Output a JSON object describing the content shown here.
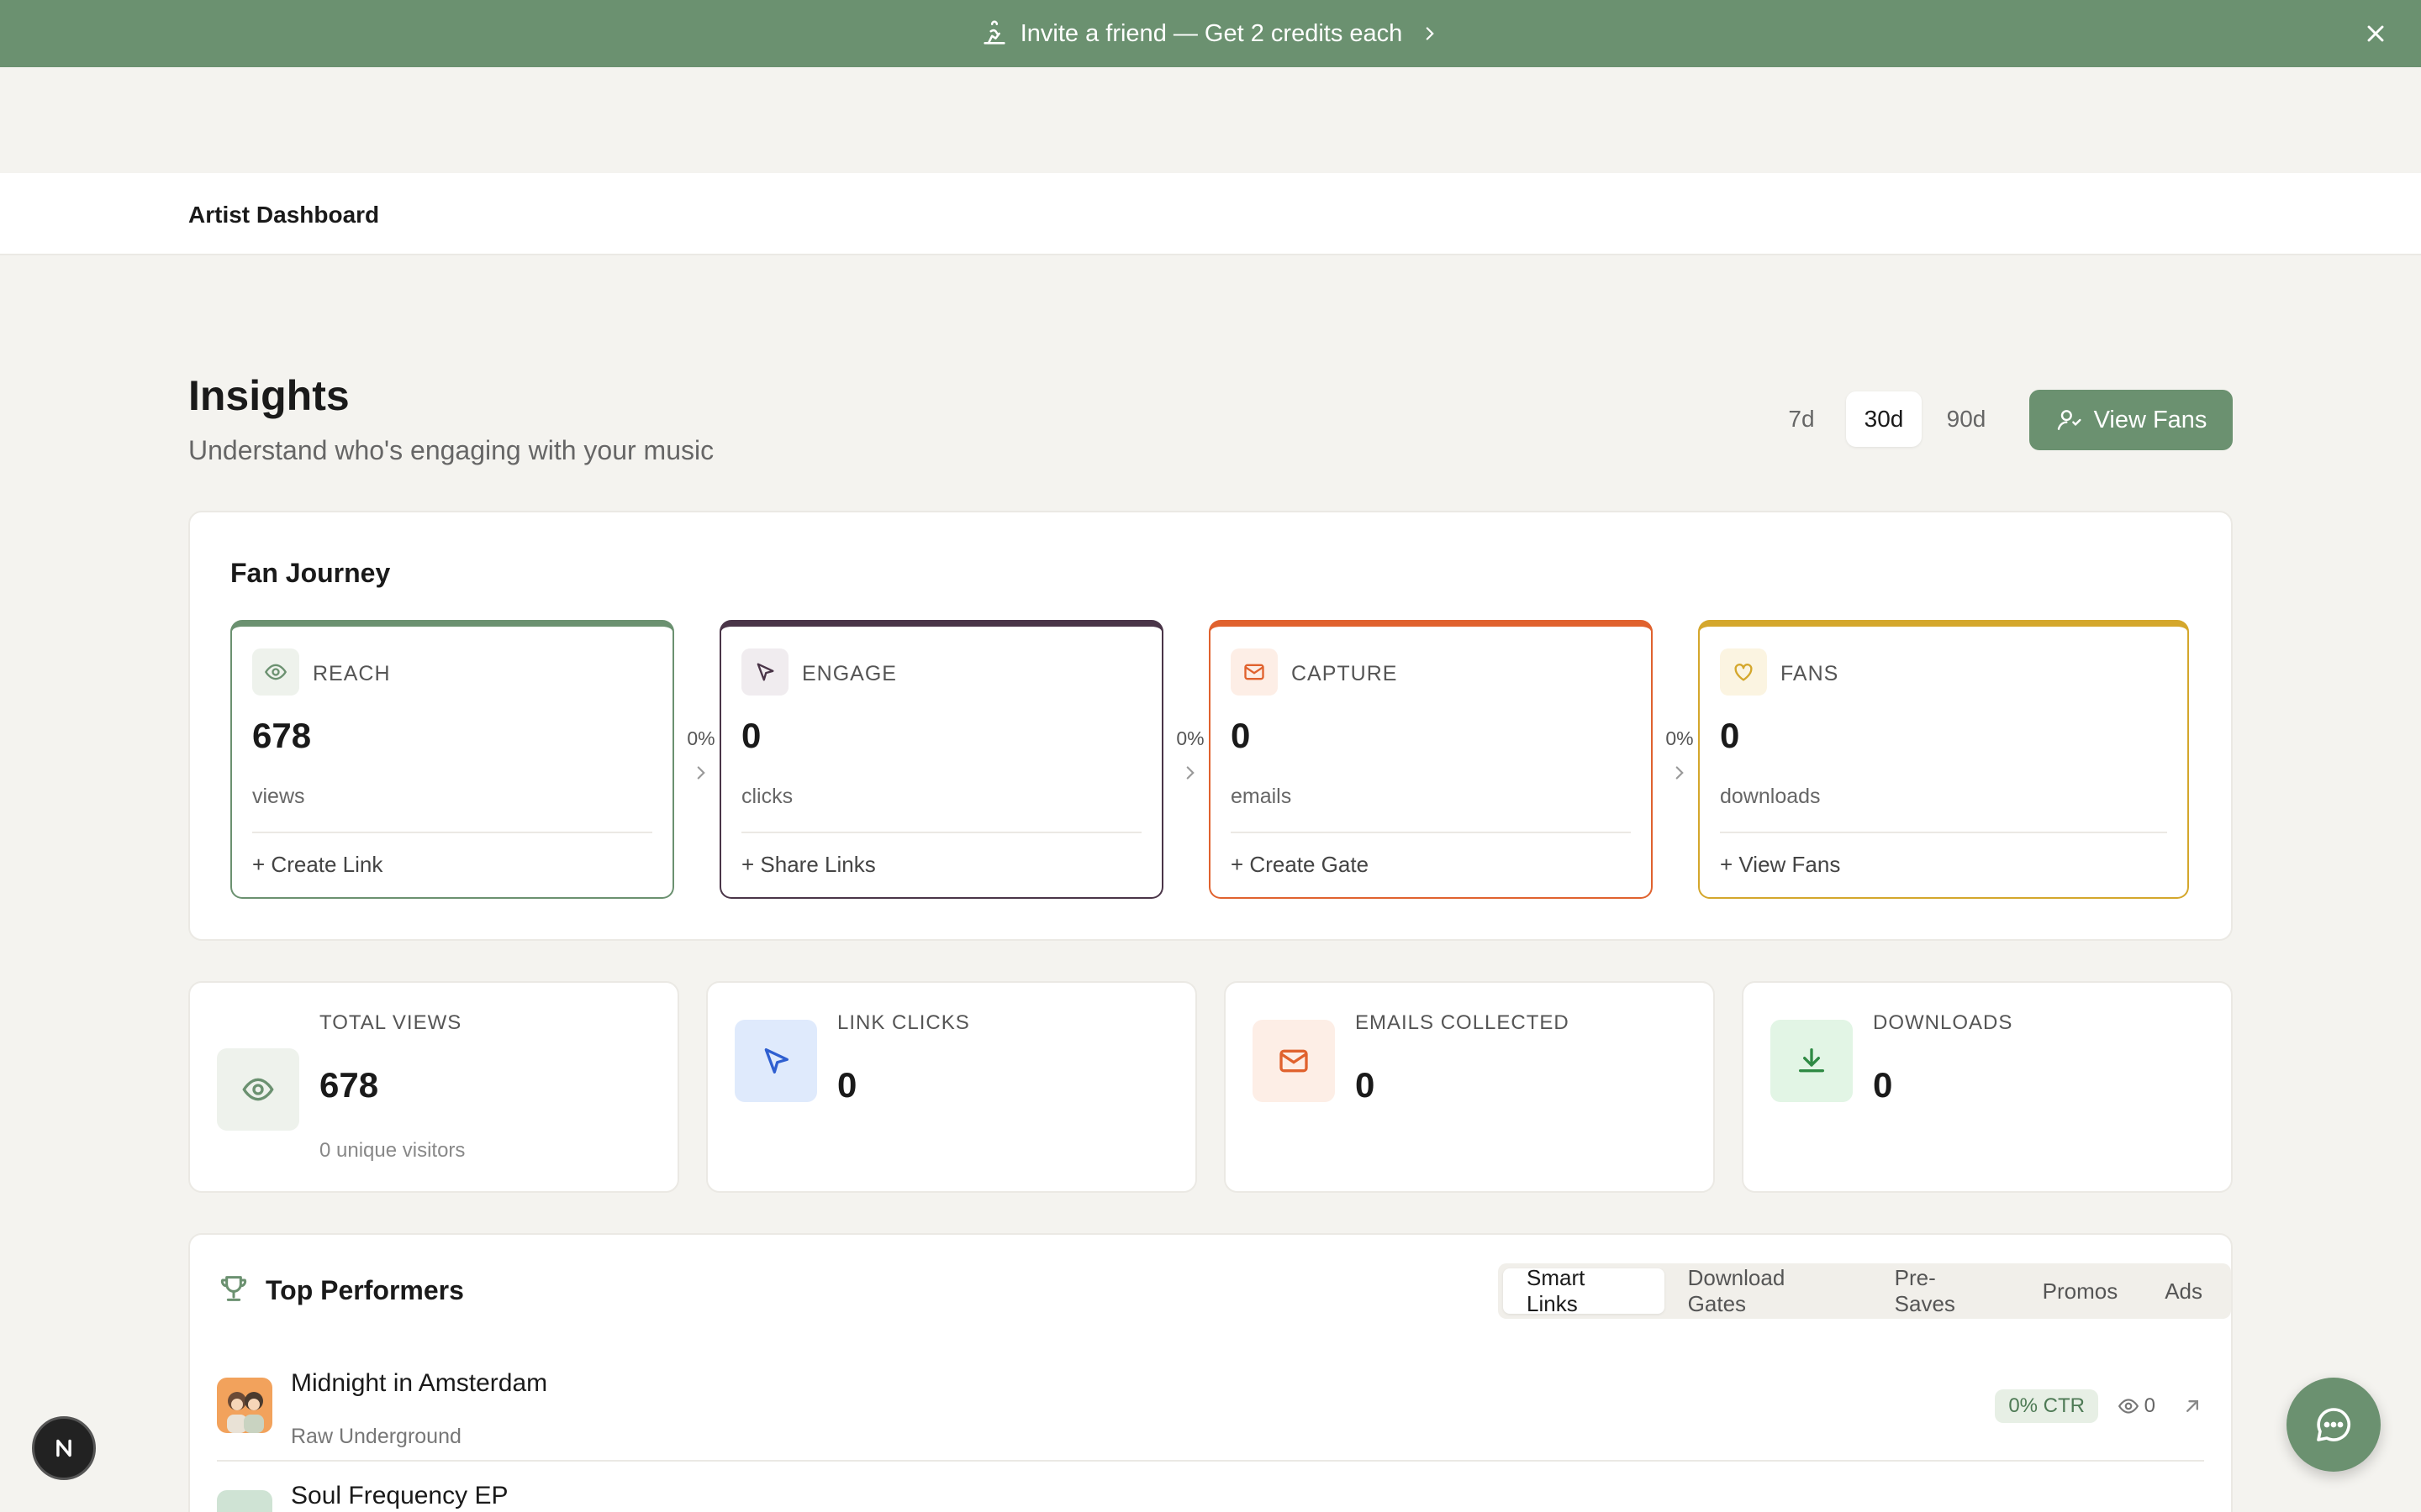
{
  "banner": {
    "text": "Invite a friend — Get 2 credits each",
    "bg": "#6b9170"
  },
  "topbar": {
    "title": "Artist Dashboard"
  },
  "insights": {
    "title": "Insights",
    "subtitle": "Understand who's engaging with your music",
    "ranges": [
      "7d",
      "30d",
      "90d"
    ],
    "selected_range": "30d",
    "view_fans_label": "View Fans"
  },
  "journey": {
    "title": "Fan Journey",
    "stages": [
      {
        "label": "REACH",
        "value": "678",
        "unit": "views",
        "action": "Create Link",
        "color": "#6b9170",
        "icon": "eye-icon"
      },
      {
        "label": "ENGAGE",
        "value": "0",
        "unit": "clicks",
        "action": "Share Links",
        "color": "#4a3548",
        "icon": "cursor-icon"
      },
      {
        "label": "CAPTURE",
        "value": "0",
        "unit": "emails",
        "action": "Create Gate",
        "color": "#e0622e",
        "icon": "mail-icon"
      },
      {
        "label": "FANS",
        "value": "0",
        "unit": "downloads",
        "action": "View Fans",
        "color": "#d4a72c",
        "icon": "heart-icon"
      }
    ],
    "conversions": [
      "0%",
      "0%",
      "0%"
    ]
  },
  "stats": [
    {
      "label": "TOTAL VIEWS",
      "value": "678",
      "sub": "0 unique visitors",
      "icon": "eye-icon"
    },
    {
      "label": "LINK CLICKS",
      "value": "0",
      "icon": "cursor-icon"
    },
    {
      "label": "EMAILS COLLECTED",
      "value": "0",
      "icon": "mail-icon"
    },
    {
      "label": "DOWNLOADS",
      "value": "0",
      "icon": "download-icon"
    }
  ],
  "top_performers": {
    "title": "Top Performers",
    "tabs": [
      "Smart Links",
      "Download Gates",
      "Pre-Saves",
      "Promos",
      "Ads"
    ],
    "active_tab": "Smart Links",
    "items": [
      {
        "name": "Midnight in Amsterdam",
        "artist": "Raw Underground",
        "ctr": "0% CTR",
        "views": "0"
      },
      {
        "name": "Soul Frequency EP",
        "artist": "",
        "ctr": "",
        "views": ""
      }
    ]
  }
}
